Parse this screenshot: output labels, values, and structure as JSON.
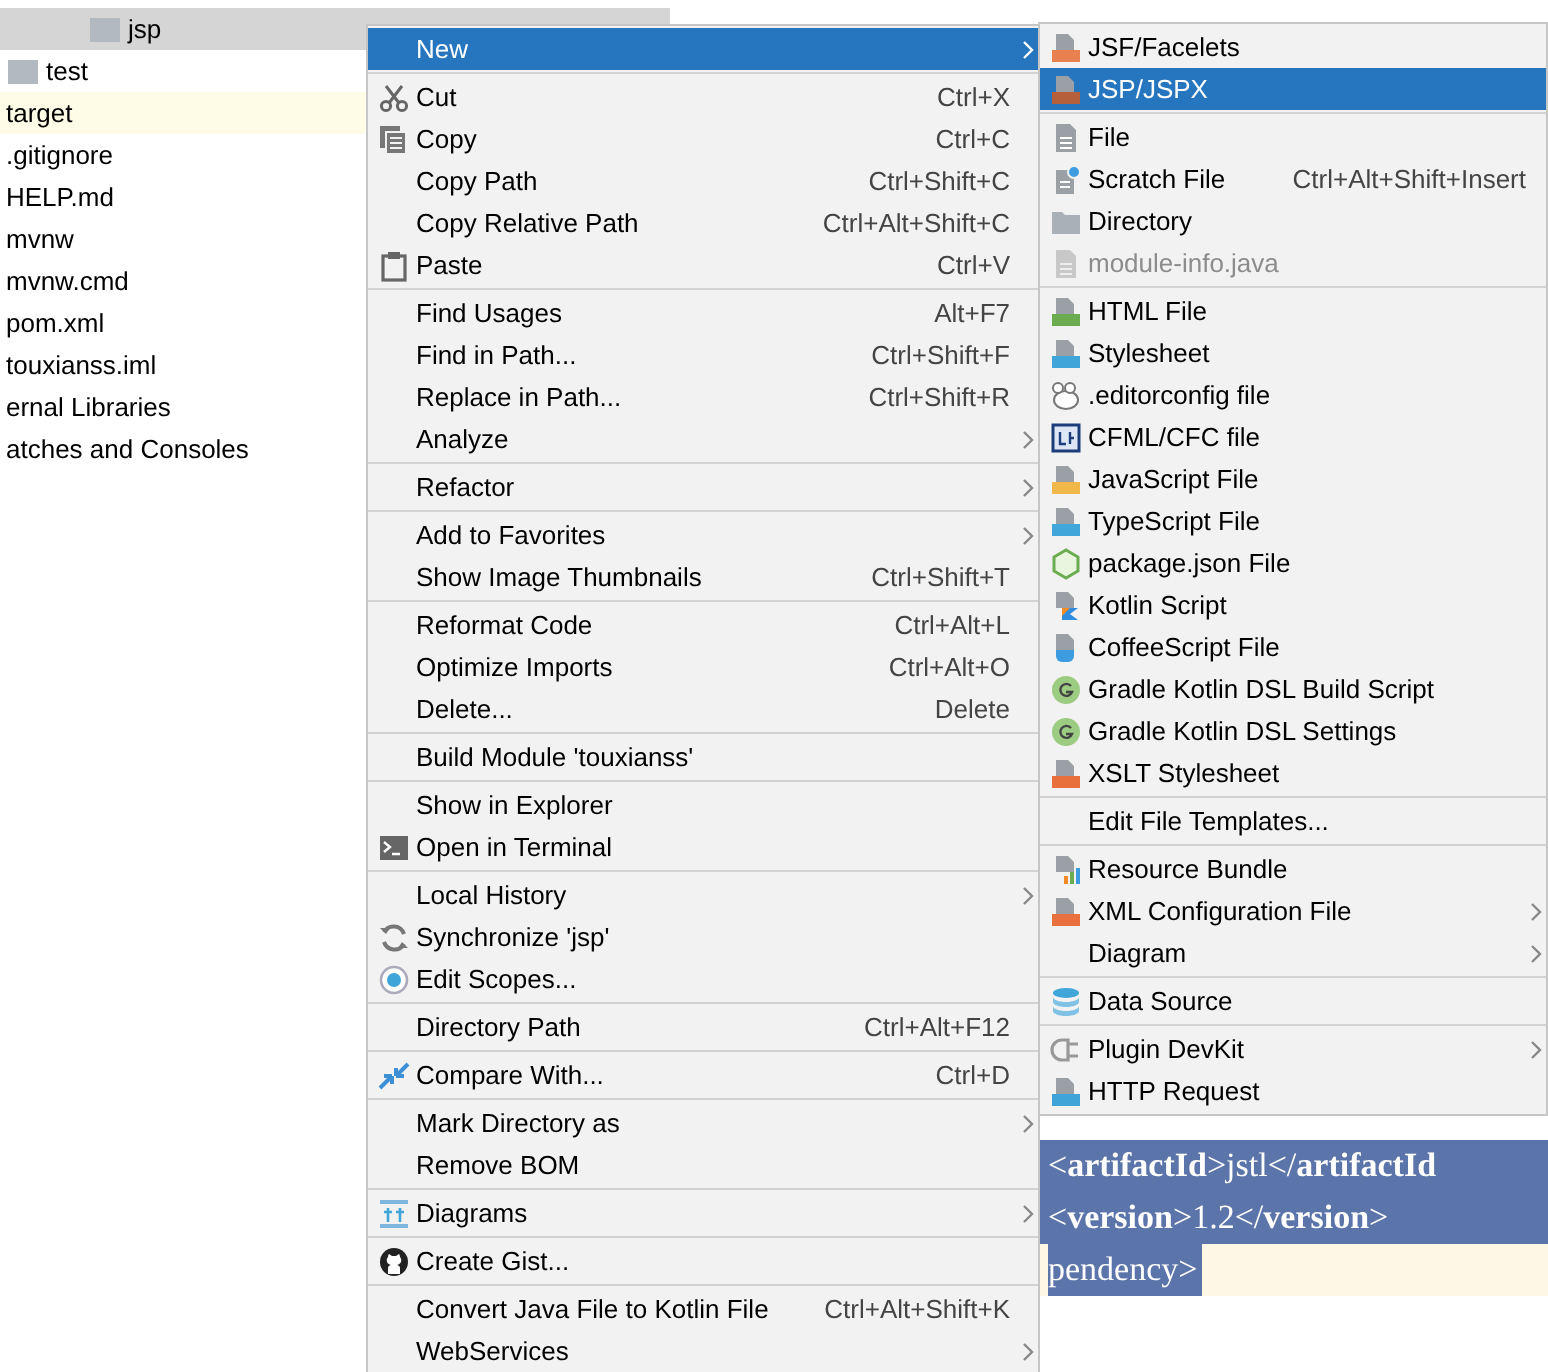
{
  "project_tree": {
    "rows": [
      {
        "label": "jsp",
        "kind": "folder",
        "selected": true,
        "highlighted": false
      },
      {
        "label": "test",
        "kind": "folder",
        "selected": false,
        "highlighted": false
      },
      {
        "label": "target",
        "kind": "plain",
        "selected": false,
        "highlighted": true
      },
      {
        "label": ".gitignore",
        "kind": "plain",
        "selected": false,
        "highlighted": false
      },
      {
        "label": "HELP.md",
        "kind": "plain",
        "selected": false,
        "highlighted": false
      },
      {
        "label": "mvnw",
        "kind": "plain",
        "selected": false,
        "highlighted": false
      },
      {
        "label": "mvnw.cmd",
        "kind": "plain",
        "selected": false,
        "highlighted": false
      },
      {
        "label": "pom.xml",
        "kind": "plain",
        "selected": false,
        "highlighted": false
      },
      {
        "label": "touxianss.iml",
        "kind": "plain",
        "selected": false,
        "highlighted": false
      },
      {
        "label": "ernal Libraries",
        "kind": "plain",
        "selected": false,
        "highlighted": false
      },
      {
        "label": "atches and Consoles",
        "kind": "plain",
        "selected": false,
        "highlighted": false
      }
    ]
  },
  "editor": {
    "lines": [
      {
        "text": "<**artifactId**>jstl</**artifactId**",
        "selected": true
      },
      {
        "text": "<**version**>1.2</**version**>",
        "selected": true
      },
      {
        "text": "pendency>",
        "selected": false
      }
    ]
  },
  "context_menu": {
    "groups": [
      {
        "items": [
          {
            "label": "New",
            "kind": "plain",
            "submenu": true,
            "selected": true
          }
        ]
      },
      {
        "items": [
          {
            "label": "Cut",
            "shortcut": "Ctrl+X",
            "kind": "scissors",
            "submenu": false,
            "selected": false
          },
          {
            "label": "Copy",
            "shortcut": "Ctrl+C",
            "kind": "copy",
            "submenu": false,
            "selected": false
          },
          {
            "label": "Copy Path",
            "shortcut": "Ctrl+Shift+C",
            "kind": "plain",
            "submenu": false,
            "selected": false
          },
          {
            "label": "Copy Relative Path",
            "shortcut": "Ctrl+Alt+Shift+C",
            "kind": "plain",
            "submenu": false,
            "selected": false
          },
          {
            "label": "Paste",
            "shortcut": "Ctrl+V",
            "kind": "clipboard",
            "submenu": false,
            "selected": false
          }
        ]
      },
      {
        "items": [
          {
            "label": "Find Usages",
            "shortcut": "Alt+F7",
            "kind": "plain",
            "submenu": false,
            "selected": false
          },
          {
            "label": "Find in Path...",
            "shortcut": "Ctrl+Shift+F",
            "kind": "plain",
            "submenu": false,
            "selected": false
          },
          {
            "label": "Replace in Path...",
            "shortcut": "Ctrl+Shift+R",
            "kind": "plain",
            "submenu": false,
            "selected": false
          },
          {
            "label": "Analyze",
            "kind": "plain",
            "submenu": true,
            "selected": false
          }
        ]
      },
      {
        "items": [
          {
            "label": "Refactor",
            "kind": "plain",
            "submenu": true,
            "selected": false
          }
        ]
      },
      {
        "items": [
          {
            "label": "Add to Favorites",
            "kind": "plain",
            "submenu": true,
            "selected": false
          },
          {
            "label": "Show Image Thumbnails",
            "shortcut": "Ctrl+Shift+T",
            "kind": "plain",
            "submenu": false,
            "selected": false
          }
        ]
      },
      {
        "items": [
          {
            "label": "Reformat Code",
            "shortcut": "Ctrl+Alt+L",
            "kind": "plain",
            "submenu": false,
            "selected": false
          },
          {
            "label": "Optimize Imports",
            "shortcut": "Ctrl+Alt+O",
            "kind": "plain",
            "submenu": false,
            "selected": false
          },
          {
            "label": "Delete...",
            "shortcut": "Delete",
            "kind": "plain",
            "submenu": false,
            "selected": false
          }
        ]
      },
      {
        "items": [
          {
            "label": "Build Module 'touxianss'",
            "kind": "plain",
            "submenu": false,
            "selected": false
          }
        ]
      },
      {
        "items": [
          {
            "label": "Show in Explorer",
            "kind": "plain",
            "submenu": false,
            "selected": false
          },
          {
            "label": "Open in Terminal",
            "kind": "terminal",
            "submenu": false,
            "selected": false
          }
        ]
      },
      {
        "items": [
          {
            "label": "Local History",
            "kind": "plain",
            "submenu": true,
            "selected": false
          },
          {
            "label": "Synchronize 'jsp'",
            "kind": "sync",
            "submenu": false,
            "selected": false
          },
          {
            "label": "Edit Scopes...",
            "kind": "target",
            "submenu": false,
            "selected": false
          }
        ]
      },
      {
        "items": [
          {
            "label": "Directory Path",
            "shortcut": "Ctrl+Alt+F12",
            "kind": "plain",
            "submenu": false,
            "selected": false
          }
        ]
      },
      {
        "items": [
          {
            "label": "Compare With...",
            "shortcut": "Ctrl+D",
            "kind": "compare",
            "submenu": false,
            "selected": false
          }
        ]
      },
      {
        "items": [
          {
            "label": "Mark Directory as",
            "kind": "plain",
            "submenu": true,
            "selected": false
          },
          {
            "label": "Remove BOM",
            "kind": "plain",
            "submenu": false,
            "selected": false
          }
        ]
      },
      {
        "items": [
          {
            "label": "Diagrams",
            "kind": "diagram",
            "submenu": true,
            "selected": false
          }
        ]
      },
      {
        "items": [
          {
            "label": "Create Gist...",
            "kind": "github",
            "submenu": false,
            "selected": false
          }
        ]
      },
      {
        "items": [
          {
            "label": "Convert Java File to Kotlin File",
            "shortcut": "Ctrl+Alt+Shift+K",
            "kind": "plain",
            "submenu": false,
            "selected": false
          },
          {
            "label": "WebServices",
            "kind": "plain",
            "submenu": true,
            "selected": false
          }
        ]
      }
    ]
  },
  "new_submenu": {
    "groups": [
      {
        "items": [
          {
            "label": "JSF/Facelets",
            "kind": "badge",
            "color": "#e8804f",
            "submenu": false,
            "selected": false,
            "disabled": false
          },
          {
            "label": "JSP/JSPX",
            "kind": "badge",
            "color": "#b5603a",
            "submenu": false,
            "selected": true,
            "disabled": false
          }
        ]
      },
      {
        "items": [
          {
            "label": "File",
            "kind": "file",
            "submenu": false,
            "selected": false,
            "disabled": false
          },
          {
            "label": "Scratch File",
            "shortcut": "Ctrl+Alt+Shift+Insert",
            "kind": "scratch",
            "submenu": false,
            "selected": false,
            "disabled": false
          },
          {
            "label": "Directory",
            "kind": "folder",
            "submenu": false,
            "selected": false,
            "disabled": false
          },
          {
            "label": "module-info.java",
            "kind": "file",
            "submenu": false,
            "selected": false,
            "disabled": true
          }
        ]
      },
      {
        "items": [
          {
            "label": "HTML File",
            "kind": "badge",
            "color": "#6aac4f",
            "submenu": false,
            "selected": false,
            "disabled": false
          },
          {
            "label": "Stylesheet",
            "kind": "badge",
            "color": "#40a6d9",
            "submenu": false,
            "selected": false,
            "disabled": false
          },
          {
            "label": ".editorconfig file",
            "kind": "editorconfig",
            "submenu": false,
            "selected": false,
            "disabled": false
          },
          {
            "label": "CFML/CFC file",
            "kind": "cfml",
            "submenu": false,
            "selected": false,
            "disabled": false
          },
          {
            "label": "JavaScript File",
            "kind": "badge",
            "color": "#f0b84a",
            "submenu": false,
            "selected": false,
            "disabled": false
          },
          {
            "label": "TypeScript File",
            "kind": "badge",
            "color": "#41a7da",
            "submenu": false,
            "selected": false,
            "disabled": false
          },
          {
            "label": "package.json File",
            "kind": "node",
            "submenu": false,
            "selected": false,
            "disabled": false
          },
          {
            "label": "Kotlin Script",
            "kind": "kotlin",
            "submenu": false,
            "selected": false,
            "disabled": false
          },
          {
            "label": "CoffeeScript File",
            "kind": "coffee",
            "submenu": false,
            "selected": false,
            "disabled": false
          },
          {
            "label": "Gradle Kotlin DSL Build Script",
            "kind": "gradle",
            "submenu": false,
            "selected": false,
            "disabled": false
          },
          {
            "label": "Gradle Kotlin DSL Settings",
            "kind": "gradle",
            "submenu": false,
            "selected": false,
            "disabled": false
          },
          {
            "label": "XSLT Stylesheet",
            "kind": "badge",
            "color": "#e8703d",
            "submenu": false,
            "selected": false,
            "disabled": false
          }
        ]
      },
      {
        "items": [
          {
            "label": "Edit File Templates...",
            "kind": "plain",
            "submenu": false,
            "selected": false,
            "disabled": false
          }
        ]
      },
      {
        "items": [
          {
            "label": "Resource Bundle",
            "kind": "bars",
            "submenu": false,
            "selected": false,
            "disabled": false
          },
          {
            "label": "XML Configuration File",
            "kind": "badge",
            "color": "#e9713e",
            "submenu": true,
            "selected": false,
            "disabled": false
          },
          {
            "label": "Diagram",
            "kind": "plain",
            "submenu": true,
            "selected": false,
            "disabled": false
          }
        ]
      },
      {
        "items": [
          {
            "label": "Data Source",
            "kind": "database",
            "submenu": false,
            "selected": false,
            "disabled": false
          }
        ]
      },
      {
        "items": [
          {
            "label": "Plugin DevKit",
            "kind": "plug",
            "submenu": true,
            "selected": false,
            "disabled": false
          },
          {
            "label": "HTTP Request",
            "kind": "badge",
            "color": "#3fa5d8",
            "submenu": false,
            "selected": false,
            "disabled": false
          }
        ]
      }
    ]
  }
}
